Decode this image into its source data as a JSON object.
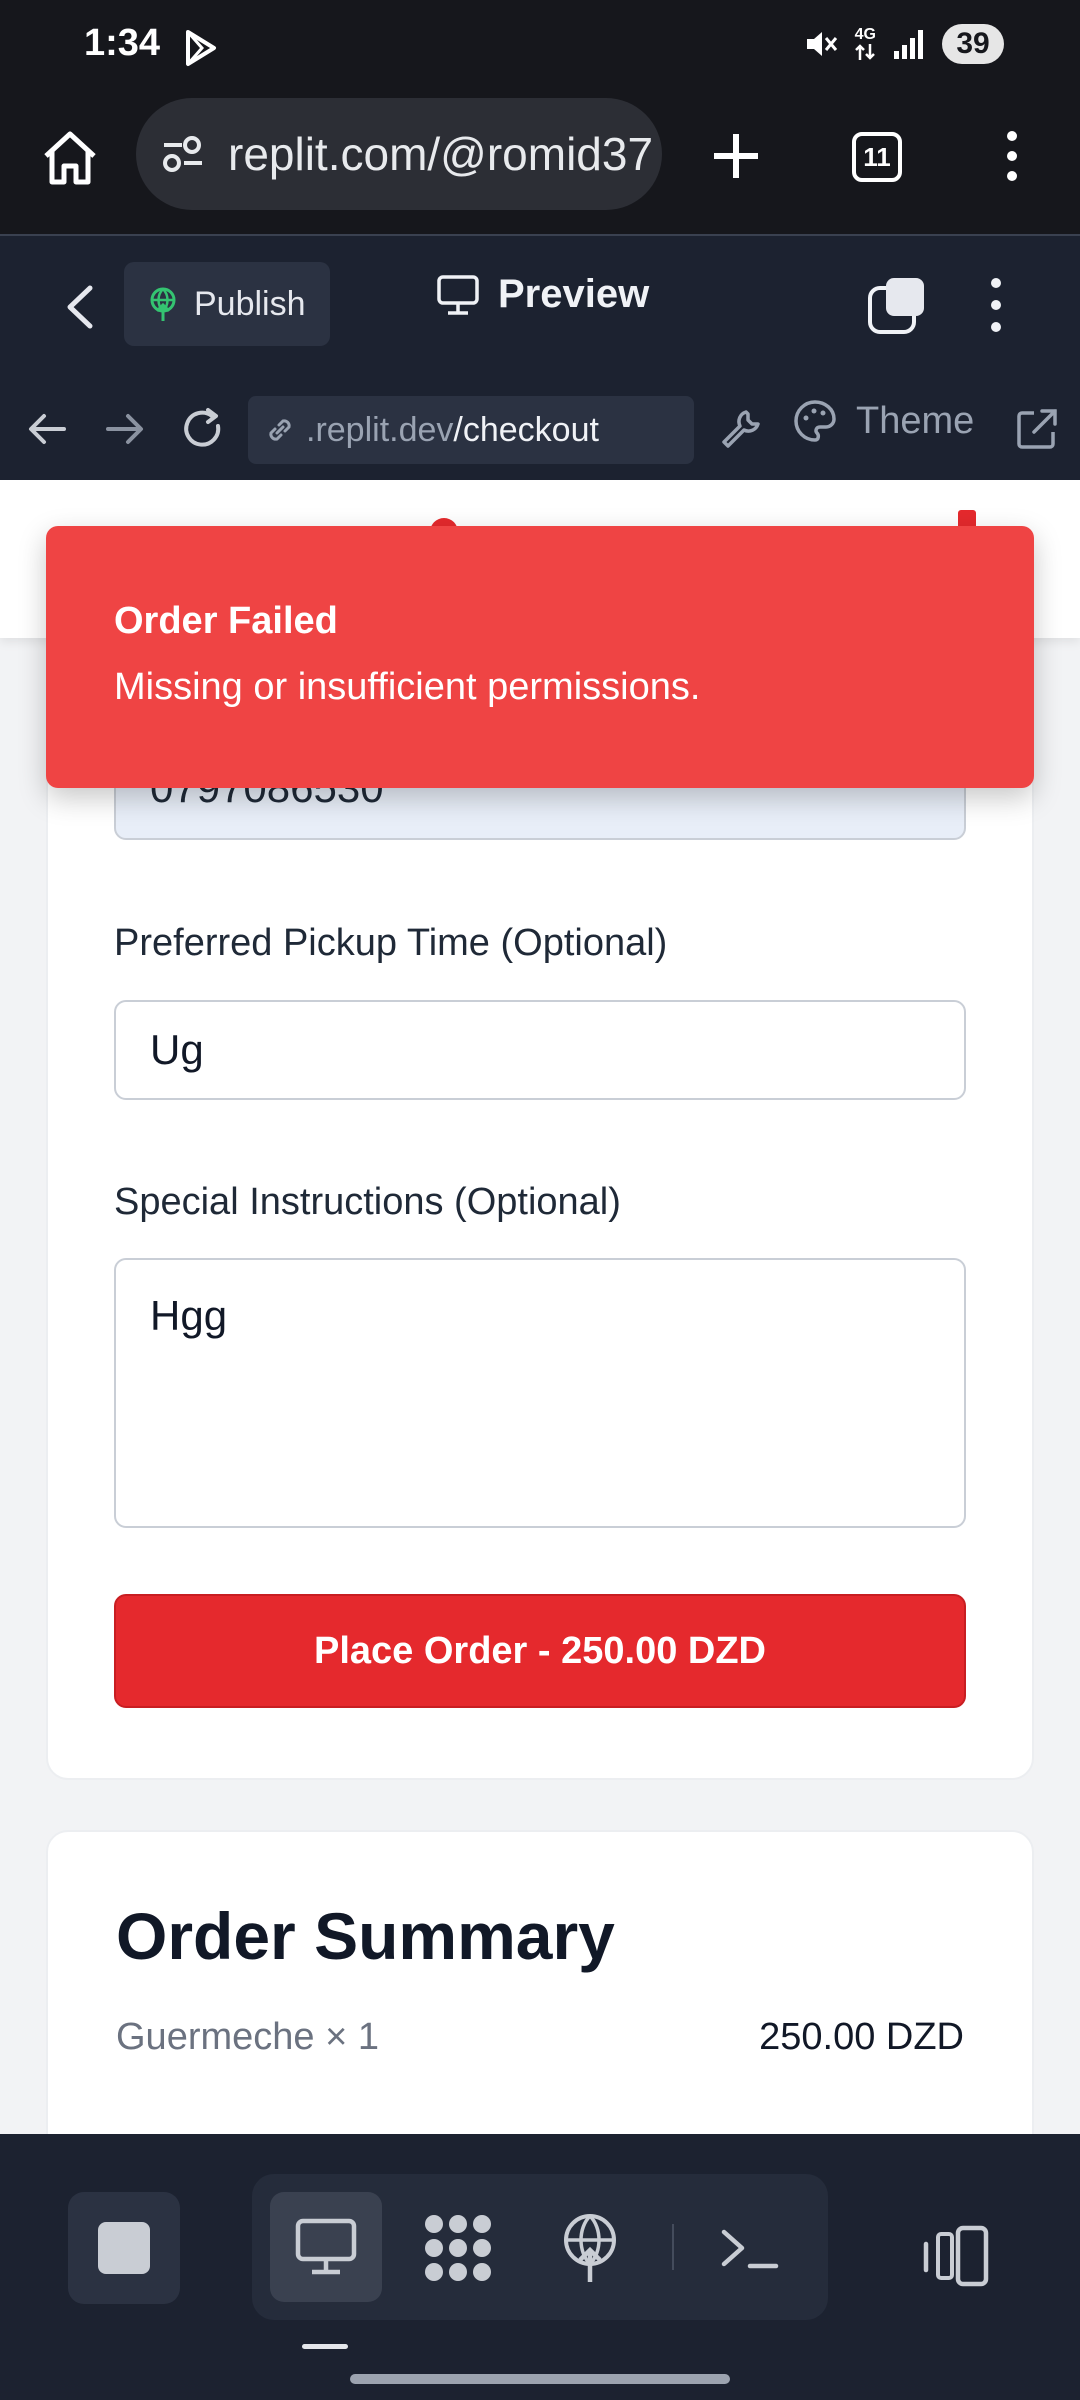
{
  "status_bar": {
    "time": "1:34",
    "network": "4G",
    "battery": "39"
  },
  "browser": {
    "url": "replit.com/@romid37",
    "tab_count": "11"
  },
  "replit_header": {
    "publish_label": "Publish",
    "preview_label": "Preview"
  },
  "replit_nav": {
    "address_host": ".replit.dev",
    "address_path": "/checkout",
    "theme_label": "Theme"
  },
  "toast": {
    "title": "Order Failed",
    "message": "Missing or insufficient permissions."
  },
  "form": {
    "phone_value": "0797086530",
    "pickup_label": "Preferred Pickup Time (Optional)",
    "pickup_value": "Ug",
    "instructions_label": "Special Instructions (Optional)",
    "instructions_value": "Hgg",
    "place_order_label": "Place Order - 250.00 DZD"
  },
  "summary": {
    "title": "Order Summary",
    "item": "Guermeche × 1",
    "item_price": "250.00 DZD"
  },
  "colors": {
    "accent": "#e5292d",
    "toast": "#ef4444",
    "chrome": "#16171c",
    "ide": "#1c2230"
  }
}
